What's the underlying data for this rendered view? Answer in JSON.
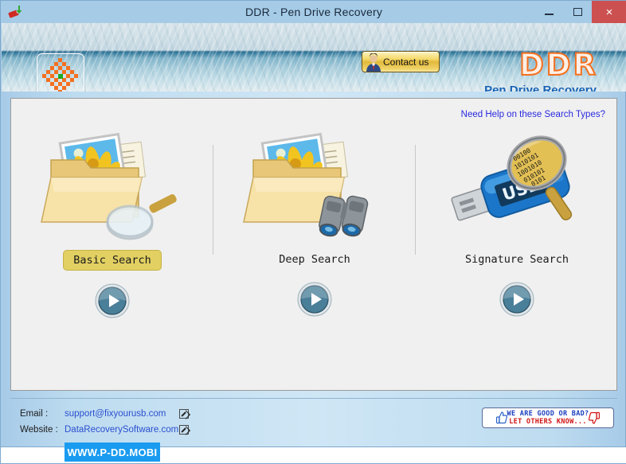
{
  "window": {
    "title": "DDR - Pen Drive Recovery",
    "app_icon": "usb-drive-icon",
    "controls": {
      "minimize": "minimize-icon",
      "maximize": "maximize-icon",
      "close": "×"
    },
    "accent_close": "#cc5050",
    "titlebar_color": "#a5cbe7"
  },
  "header": {
    "logo": "ddr-checkered-logo",
    "contact_button": {
      "label": "Contact us",
      "icon": "person-avatar-icon"
    },
    "brand": "DDR",
    "brand_subtitle": "Pen Drive Recovery",
    "brand_color": "#f4701f",
    "subtitle_color": "#1763b5"
  },
  "main": {
    "help_link": "Need Help on these Search Types?",
    "help_link_color": "#2a2ae0",
    "options": [
      {
        "label": "Basic Search",
        "art": "folder-photos-magnifier-icon",
        "selected": true,
        "play_button": "play-button-basic"
      },
      {
        "label": "Deep Search",
        "art": "folder-photos-binoculars-icon",
        "selected": false,
        "play_button": "play-button-deep"
      },
      {
        "label": "Signature Search",
        "art": "usb-drive-binary-magnifier-icon",
        "selected": false,
        "play_button": "play-button-signature"
      }
    ],
    "selected_label_bg": "#e2d062"
  },
  "footer": {
    "email_key": "Email :",
    "email_value": "support@fixyourusb.com",
    "website_key": "Website :",
    "website_value": "DataRecoverySoftware.com",
    "link_color": "#2a4fd0",
    "external_link_icon": "external-link-icon",
    "feedback": {
      "line1": "WE ARE GOOD OR BAD?",
      "line2": "LET OTHERS KNOW...",
      "line1_color": "#1c3fbf",
      "line2_color": "#d01414",
      "thumbs_up_icon": "thumbs-up-icon",
      "thumbs_down_icon": "thumbs-down-icon"
    },
    "watermark": "WWW.P-DD.MOBI",
    "watermark_bg": "#199bf0"
  }
}
